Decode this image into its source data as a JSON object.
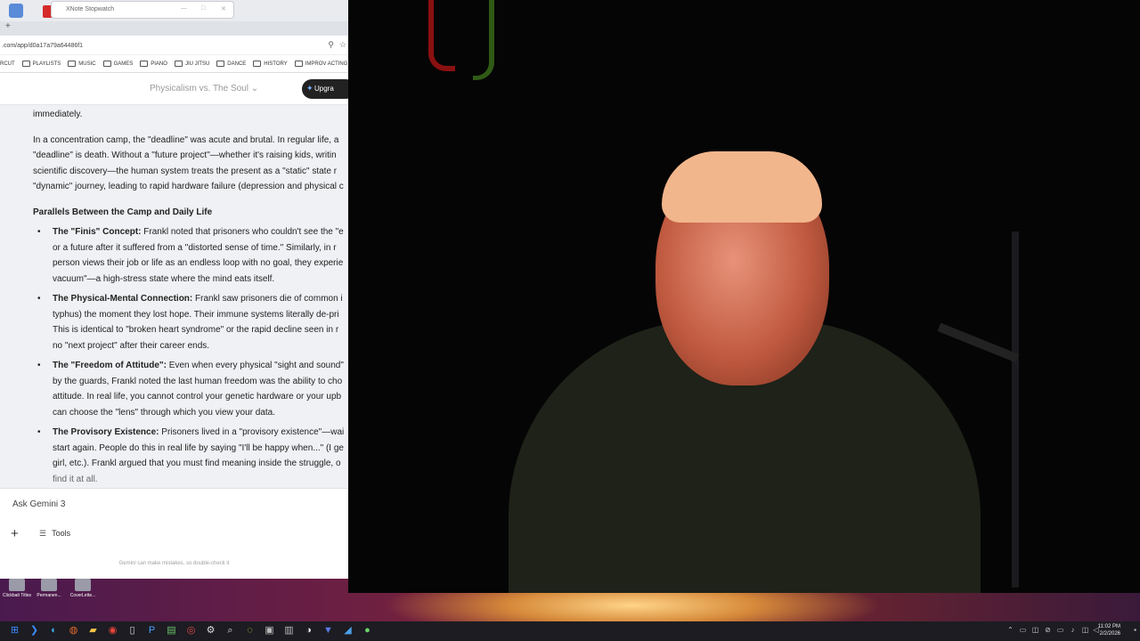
{
  "stopwatch_window": {
    "title": "XNote Stopwatch",
    "controls": [
      "—",
      "□",
      "✕"
    ]
  },
  "tabstrip": {
    "add": "+"
  },
  "address_bar": {
    "url": ".com/app/d0a17a79a64486f1"
  },
  "bookmarks": [
    "RCUT",
    "PLAYLISTS",
    "MUSIC",
    "GAMES",
    "PIANO",
    "JIU JITSU",
    "DANCE",
    "HISTORY",
    "IMPROV ACTING"
  ],
  "app_header": {
    "title": "Physicalism vs. The Soul",
    "upgrade": "Upgra"
  },
  "content": {
    "p1": "immediately.",
    "p2_lines": [
      "In a concentration camp, the \"deadline\" was acute and brutal. In regular life, a",
      "\"deadline\" is death. Without a \"future project\"—whether it's raising kids, writin",
      "scientific discovery—the human system treats the present as a \"static\" state r",
      "\"dynamic\" journey, leading to rapid hardware failure (depression and physical c"
    ],
    "heading": "Parallels Between the Camp and Daily Life",
    "bullets": [
      {
        "bold": "The \"Finis\" Concept:",
        "lines": [
          " Frankl noted that prisoners who couldn't see the \"e",
          "or a future after it suffered from a \"distorted sense of time.\" Similarly, in r",
          "person views their job or life as an endless loop with no goal, they experie",
          "vacuum\"—a high-stress state where the mind eats itself."
        ]
      },
      {
        "bold": "The Physical-Mental Connection:",
        "lines": [
          " Frankl saw prisoners die of common i",
          "typhus) the moment they lost hope. Their immune systems literally de-pri",
          "This is identical to \"broken heart syndrome\" or the rapid decline seen in r",
          "no \"next project\" after their career ends."
        ]
      },
      {
        "bold": "The \"Freedom of Attitude\":",
        "lines": [
          " Even when every physical \"sight and sound\"",
          "by the guards, Frankl noted the last human freedom was the ability to cho",
          "attitude. In real life, you cannot control your genetic hardware or your upb",
          "can choose the \"lens\" through which you view your data."
        ]
      },
      {
        "bold": "The Provisory Existence:",
        "lines": [
          " Prisoners lived in a \"provisory existence\"—wai",
          "start again. People do this in real life by saying \"I'll be happy when...\" (I ge",
          "girl, etc.). Frankl argued that you must find meaning inside the struggle, o",
          "find it at all."
        ]
      }
    ]
  },
  "composer": {
    "placeholder": "Ask Gemini 3",
    "plus": "+",
    "tools": "Tools"
  },
  "disclaimer": "Gemini can make mistakes, so double-check it",
  "desktop_icons": [
    {
      "label": "Clickbait Titles"
    },
    {
      "label": "Permanen..."
    },
    {
      "label": "CoverLette..."
    }
  ],
  "clock": {
    "time": "11:02 PM",
    "date": "2/2/2026"
  },
  "colors": {
    "accent": "#1a73e8",
    "upgrade_bg": "#222222"
  }
}
